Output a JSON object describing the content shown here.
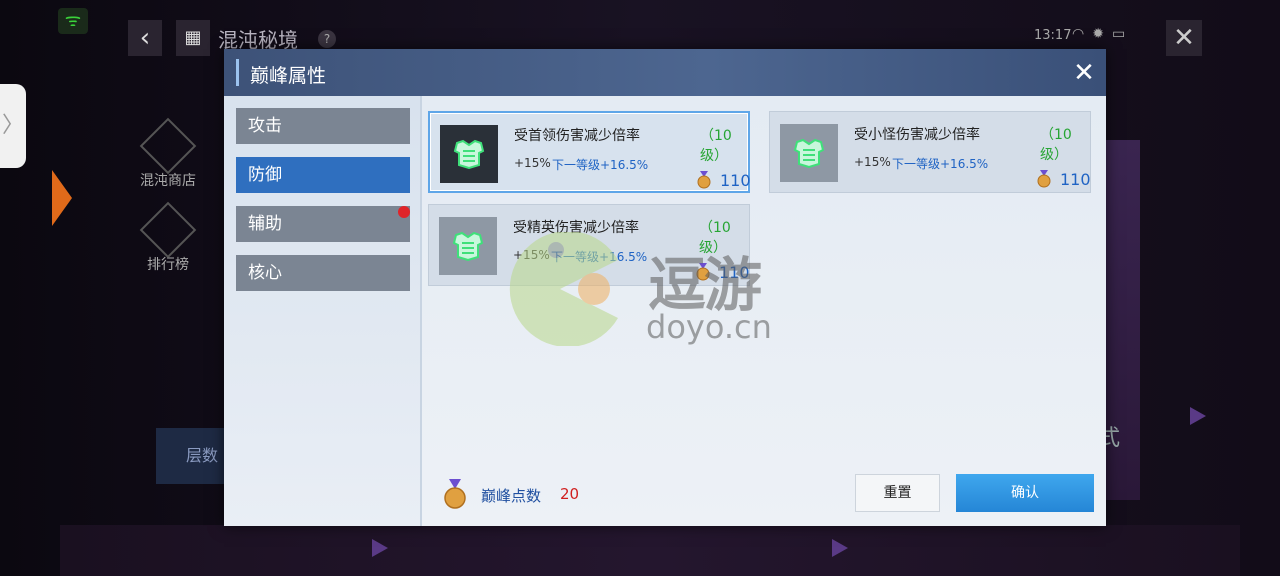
{
  "background": {
    "scene_title": "混沌秘境",
    "clock": "13:17",
    "left_menu": [
      {
        "label": "混沌商店"
      },
      {
        "label": "排行榜"
      }
    ],
    "layer_button": "层数",
    "right_hint": "式"
  },
  "dialog": {
    "title": "巅峰属性",
    "tabs": [
      {
        "label": "攻击",
        "active": false,
        "badge": false
      },
      {
        "label": "防御",
        "active": true,
        "badge": false
      },
      {
        "label": "辅助",
        "active": false,
        "badge": true
      },
      {
        "label": "核心",
        "active": false,
        "badge": false
      }
    ],
    "cards": [
      {
        "name": "受首领伤害减少倍率",
        "level": "（10级）",
        "current": "+15%",
        "next": "下一等级+16.5%",
        "cost": "110",
        "selected": true
      },
      {
        "name": "受小怪伤害减少倍率",
        "level": "（10级）",
        "current": "+15%",
        "next": "下一等级+16.5%",
        "cost": "110",
        "selected": false
      },
      {
        "name": "受精英伤害减少倍率",
        "level": "（10级）",
        "current": "+15%",
        "next": "下一等级+16.5%",
        "cost": "110",
        "selected": false
      }
    ],
    "points_label": "巅峰点数",
    "points_value": "20",
    "reset_label": "重置",
    "confirm_label": "确认"
  },
  "watermark": {
    "brand": "逗游",
    "domain": "doyo.cn"
  },
  "colors": {
    "accent_blue": "#2f6fbf",
    "level_green": "#27a534",
    "value_blue": "#1f63c4",
    "points_red": "#d02020"
  }
}
